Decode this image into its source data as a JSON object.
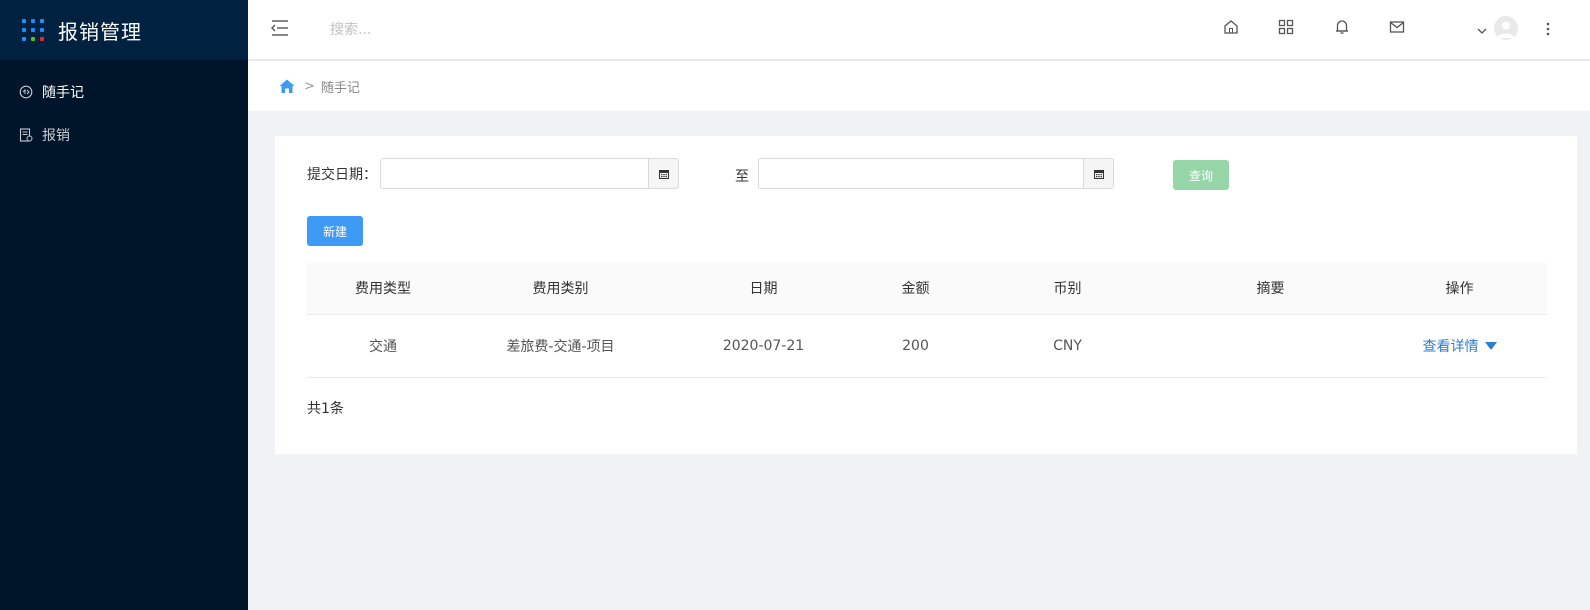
{
  "app": {
    "title": "报销管理",
    "brand_dot_colors": [
      "#1890ff",
      "#1890ff",
      "#1890ff",
      "#1890ff",
      "#1890ff",
      "#1890ff",
      "#1890ff",
      "#52c41a",
      "#f5222d"
    ]
  },
  "sidebar": {
    "items": [
      {
        "label": "随手记",
        "icon": "notes-icon",
        "active": true
      },
      {
        "label": "报销",
        "icon": "reimburse-icon",
        "active": false
      }
    ]
  },
  "header": {
    "search_placeholder": "搜索...",
    "icons": [
      "home-icon",
      "apps-icon",
      "bell-icon",
      "mail-icon",
      "chevron-down-icon",
      "avatar",
      "more-vertical-icon"
    ]
  },
  "breadcrumb": {
    "separator": ">",
    "current": "随手记"
  },
  "filter": {
    "date_label": "提交日期：",
    "start_value": "",
    "to_label": "至",
    "end_value": "",
    "query_label": "查询"
  },
  "actions": {
    "new_label": "新建"
  },
  "table": {
    "columns": [
      "费用类型",
      "费用类别",
      "日期",
      "金额",
      "币别",
      "摘要",
      "操作"
    ],
    "rows": [
      {
        "type": "交通",
        "category": "差旅费-交通-项目",
        "date": "2020-07-21",
        "amount": "200",
        "currency": "CNY",
        "summary": "",
        "action": "查看详情"
      }
    ]
  },
  "footer": {
    "total": "共1条"
  },
  "colors": {
    "sidebar_bg": "#001529",
    "brand_bg": "#002140",
    "primary": "#3e9bf5",
    "query_btn": "#95d5a8",
    "link": "#2c7cd1"
  }
}
